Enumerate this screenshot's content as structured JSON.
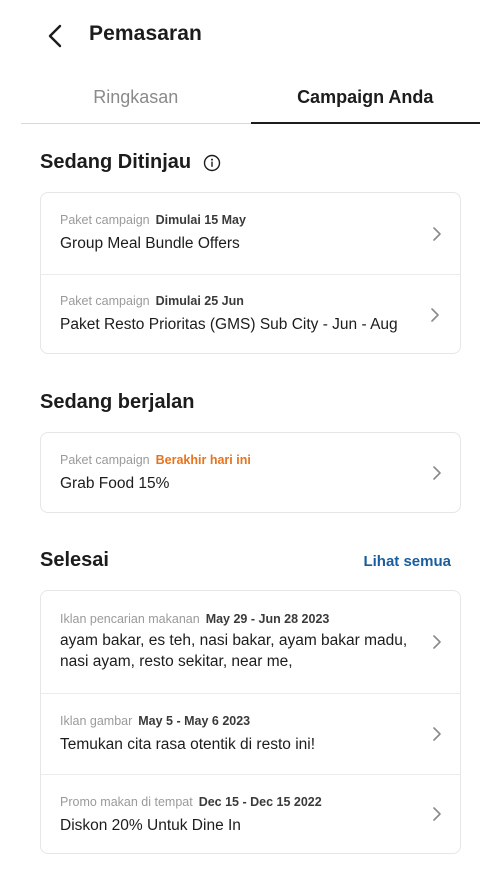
{
  "header": {
    "title": "Pemasaran"
  },
  "tabs": [
    {
      "label": "Ringkasan"
    },
    {
      "label": "Campaign Anda"
    }
  ],
  "sections": {
    "review": {
      "title": "Sedang Ditinjau",
      "items": [
        {
          "type": "Paket campaign",
          "date": "Dimulai 15 May",
          "title": "Group Meal Bundle Offers"
        },
        {
          "type": "Paket campaign",
          "date": "Dimulai 25 Jun",
          "title": "Paket Resto Prioritas (GMS) Sub City - Jun - Aug"
        }
      ]
    },
    "running": {
      "title": "Sedang berjalan",
      "items": [
        {
          "type": "Paket campaign",
          "date": "Berakhir hari ini",
          "title": "Grab Food 15%"
        }
      ]
    },
    "done": {
      "title": "Selesai",
      "see_all": "Lihat semua",
      "items": [
        {
          "type": "Iklan pencarian makanan",
          "date": "May 29 - Jun 28 2023",
          "title": "ayam bakar, es teh, nasi bakar, ayam bakar madu, nasi ayam, resto sekitar, near me,"
        },
        {
          "type": "Iklan gambar",
          "date": "May 5 - May 6 2023",
          "title": "Temukan cita rasa otentik di resto ini!"
        },
        {
          "type": "Promo makan di tempat",
          "date": "Dec 15 - Dec 15 2022",
          "title": "Diskon 20% Untuk Dine In"
        }
      ]
    }
  },
  "icons": {
    "back": "back-arrow-icon",
    "info": "info-icon",
    "chevron": "chevron-right-icon"
  },
  "colors": {
    "accent_link": "#1a5d9e",
    "urgent": "#e8731c",
    "muted": "#9a9a9a"
  }
}
